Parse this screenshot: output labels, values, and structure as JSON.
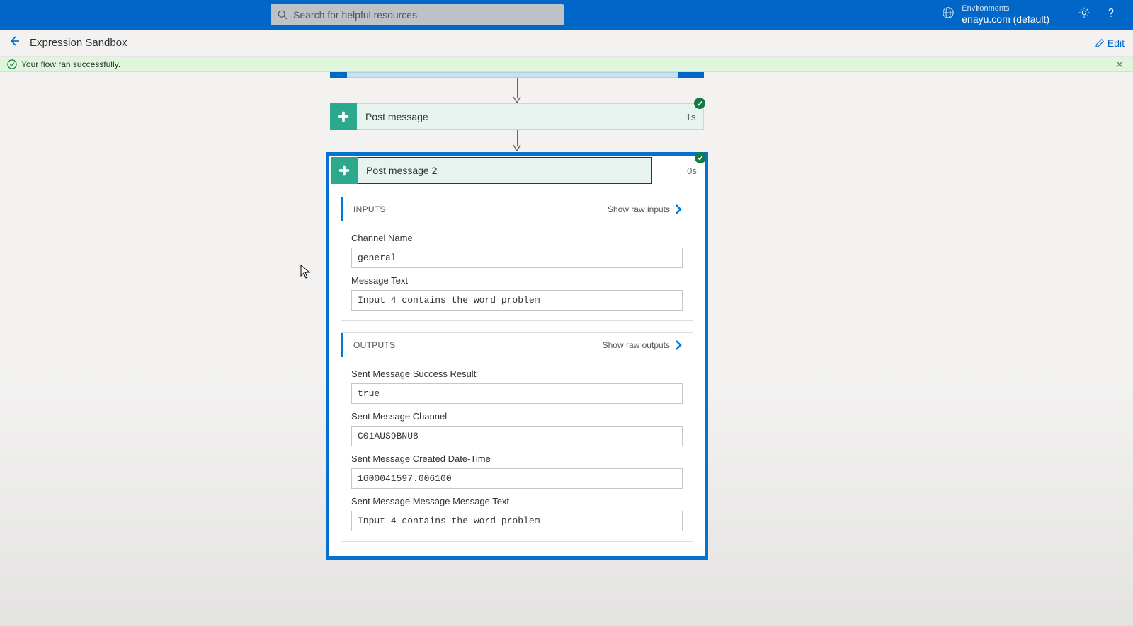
{
  "header": {
    "search_placeholder": "Search for helpful resources",
    "env_label": "Environments",
    "env_value": "enayu.com (default)"
  },
  "subheader": {
    "title": "Expression Sandbox",
    "edit_label": "Edit"
  },
  "banner": {
    "message": "Your flow ran successfully."
  },
  "step1": {
    "title": "Post message",
    "duration": "1s"
  },
  "step2": {
    "title": "Post message 2",
    "duration": "0s",
    "inputs": {
      "section_label": "INPUTS",
      "raw_link": "Show raw inputs",
      "channel_name_label": "Channel Name",
      "channel_name_value": "general",
      "message_text_label": "Message Text",
      "message_text_value": "Input 4 contains the word problem"
    },
    "outputs": {
      "section_label": "OUTPUTS",
      "raw_link": "Show raw outputs",
      "success_label": "Sent Message Success Result",
      "success_value": "true",
      "channel_label": "Sent Message Channel",
      "channel_value": "C01AUS9BNU8",
      "created_label": "Sent Message Created Date-Time",
      "created_value": "1600041597.006100",
      "msgtext_label": "Sent Message Message Message Text",
      "msgtext_value": "Input 4 contains the word problem"
    }
  }
}
